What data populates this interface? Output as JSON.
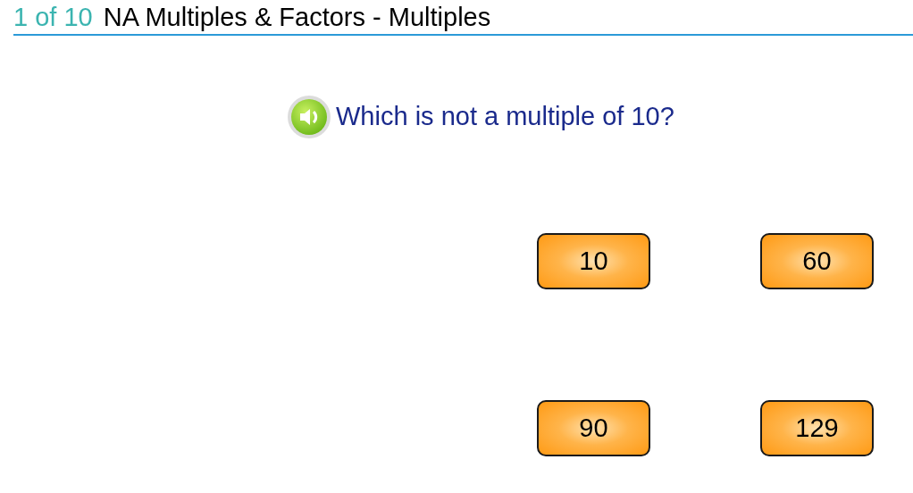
{
  "header": {
    "progress": "1 of 10",
    "title": "NA Multiples & Factors - Multiples"
  },
  "question": {
    "text": "Which is not a multiple of 10?"
  },
  "answers": [
    {
      "label": "10"
    },
    {
      "label": "60"
    },
    {
      "label": "90"
    },
    {
      "label": "129"
    }
  ]
}
